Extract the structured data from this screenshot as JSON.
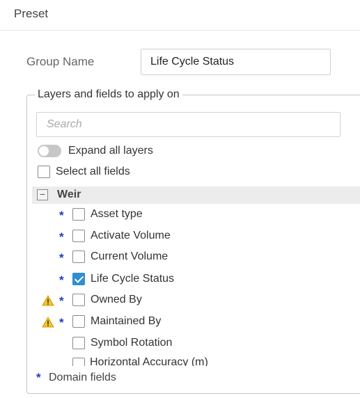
{
  "header": {
    "title": "Preset"
  },
  "group": {
    "label": "Group Name",
    "value": "Life Cycle Status"
  },
  "layers_section": {
    "legend": "Layers and fields to apply on",
    "search_placeholder": "Search",
    "expand_all_label": "Expand all layers",
    "expand_all_on": false,
    "select_all_label": "Select all fields",
    "select_all_checked": false
  },
  "layer": {
    "name": "Weir",
    "collapse_symbol": "−",
    "fields": [
      {
        "label": "Asset type",
        "domain": true,
        "warning": false,
        "checked": false
      },
      {
        "label": "Activate Volume",
        "domain": true,
        "warning": false,
        "checked": false
      },
      {
        "label": "Current Volume",
        "domain": true,
        "warning": false,
        "checked": false
      },
      {
        "label": "Life Cycle Status",
        "domain": true,
        "warning": false,
        "checked": true
      },
      {
        "label": "Owned By",
        "domain": true,
        "warning": true,
        "checked": false
      },
      {
        "label": "Maintained By",
        "domain": true,
        "warning": true,
        "checked": false
      },
      {
        "label": "Symbol Rotation",
        "domain": false,
        "warning": false,
        "checked": false
      },
      {
        "label": "Horizontal Accuracy (m)",
        "domain": false,
        "warning": false,
        "checked": false
      }
    ]
  },
  "footer": {
    "star": "*",
    "label": "Domain fields"
  },
  "icons": {
    "domain_marker": "*",
    "warning": "warning-triangle-icon",
    "collapse": "minus-box-icon"
  },
  "colors": {
    "accent": "#2f8ecf",
    "domain_star": "#1c3cc7",
    "warning": "#f2c12e"
  }
}
